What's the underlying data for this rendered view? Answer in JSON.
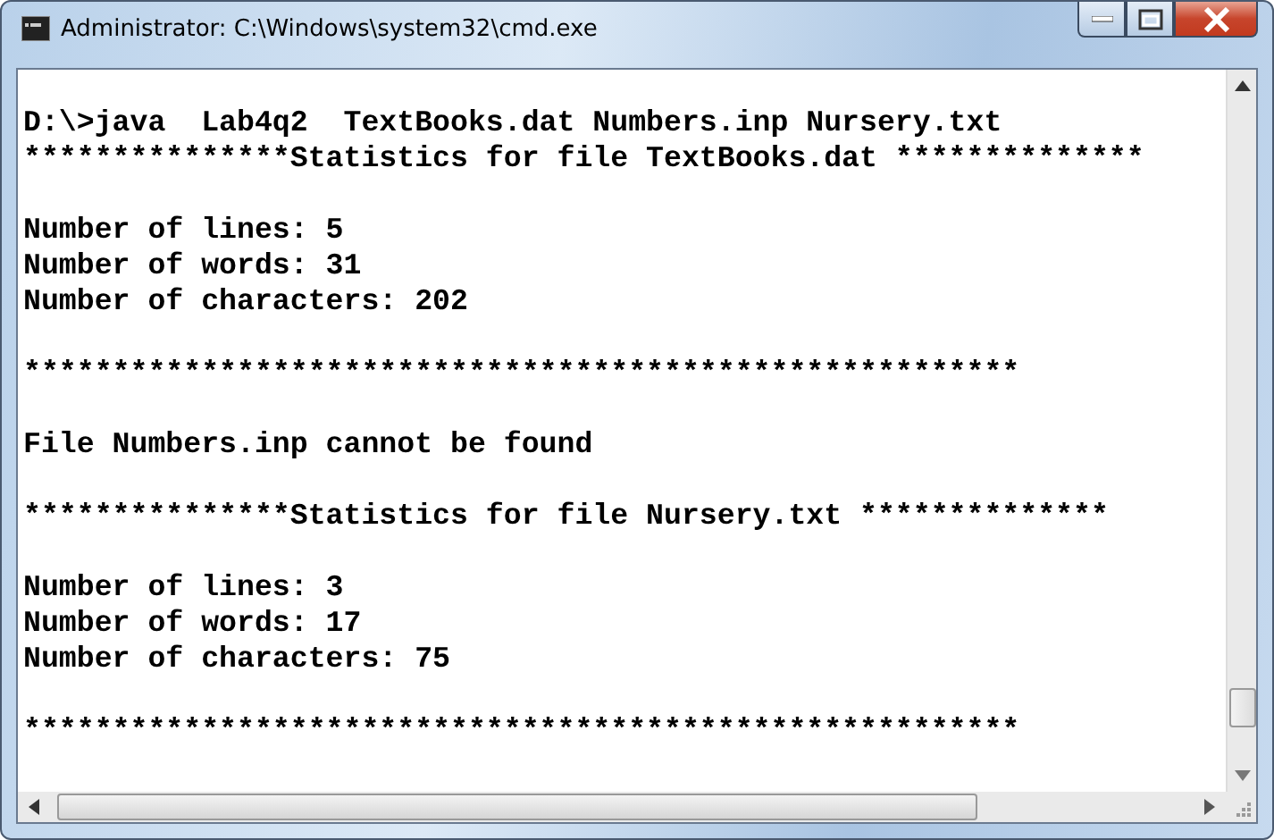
{
  "window": {
    "title": "Administrator: C:\\Windows\\system32\\cmd.exe"
  },
  "console": {
    "blocks": [
      [
        "D:\\>java  Lab4q2  TextBooks.dat Numbers.inp Nursery.txt",
        "***************Statistics for file TextBooks.dat **************"
      ],
      [
        "Number of lines: 5",
        "Number of words: 31",
        "Number of characters: 202"
      ],
      [
        "********************************************************"
      ],
      [
        "File Numbers.inp cannot be found"
      ],
      [
        "***************Statistics for file Nursery.txt **************"
      ],
      [
        "Number of lines: 3",
        "Number of words: 17",
        "Number of characters: 75"
      ],
      [
        "********************************************************"
      ]
    ]
  }
}
